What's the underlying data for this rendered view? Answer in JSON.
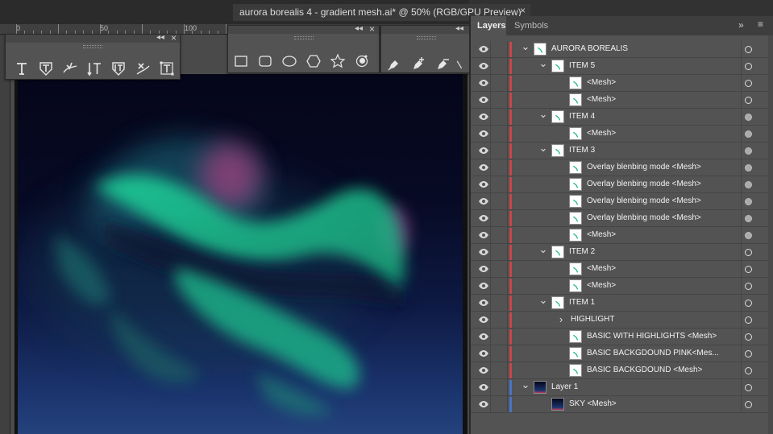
{
  "document": {
    "tab_title": "aurora borealis 4 - gradient mesh.ai* @ 50% (RGB/GPU Preview)",
    "close_glyph": "×"
  },
  "ruler": {
    "labels": [
      "0",
      "50",
      "100"
    ]
  },
  "toolbars": {
    "type_tools": {
      "collapse_glyph": "◂◂",
      "close_glyph": "×",
      "tools": [
        "type-tool-icon",
        "type-on-path-icon",
        "touch-type-icon",
        "vertical-type-icon",
        "area-type-icon",
        "reflect-type-icon",
        "bounding-type-icon"
      ]
    },
    "shape_tools": {
      "collapse_glyph": "◂◂",
      "close_glyph": "×",
      "tools": [
        "rectangle-icon",
        "rounded-rectangle-icon",
        "ellipse-icon",
        "polygon-icon",
        "star-icon",
        "flare-icon"
      ]
    },
    "pen_tools": {
      "collapse_glyph": "◂◂",
      "tools": [
        "pen-icon",
        "add-anchor-icon",
        "delete-anchor-icon",
        "anchor-point-icon"
      ]
    }
  },
  "layers_panel": {
    "tabs": [
      {
        "label": "Layers",
        "active": true
      },
      {
        "label": "Symbols",
        "active": false
      }
    ],
    "collapse_glyph": "»",
    "menu_glyph": "≡",
    "accent_red": "#c8464a",
    "accent_blue": "#4a74c8",
    "rows": [
      {
        "name": "AURORA BOREALIS",
        "depth": 0,
        "expand": "open",
        "color": "red",
        "target_filled": false
      },
      {
        "name": "ITEM 5",
        "depth": 1,
        "expand": "open",
        "color": "red",
        "target_filled": false
      },
      {
        "name": "<Mesh>",
        "depth": 2,
        "expand": "none",
        "color": "red",
        "target_filled": false
      },
      {
        "name": "<Mesh>",
        "depth": 2,
        "expand": "none",
        "color": "red",
        "target_filled": false
      },
      {
        "name": "ITEM 4",
        "depth": 1,
        "expand": "open",
        "color": "red",
        "target_filled": true
      },
      {
        "name": "<Mesh>",
        "depth": 2,
        "expand": "none",
        "color": "red",
        "target_filled": true
      },
      {
        "name": "ITEM 3",
        "depth": 1,
        "expand": "open",
        "color": "red",
        "target_filled": true
      },
      {
        "name": "Overlay blenbing mode <Mesh>",
        "depth": 2,
        "expand": "none",
        "color": "red",
        "target_filled": true
      },
      {
        "name": "Overlay blenbing mode <Mesh>",
        "depth": 2,
        "expand": "none",
        "color": "red",
        "target_filled": true
      },
      {
        "name": "Overlay blenbing mode <Mesh>",
        "depth": 2,
        "expand": "none",
        "color": "red",
        "target_filled": true
      },
      {
        "name": "Overlay blenbing mode <Mesh>",
        "depth": 2,
        "expand": "none",
        "color": "red",
        "target_filled": true
      },
      {
        "name": "<Mesh>",
        "depth": 2,
        "expand": "none",
        "color": "red",
        "target_filled": true
      },
      {
        "name": "ITEM 2",
        "depth": 1,
        "expand": "open",
        "color": "red",
        "target_filled": false
      },
      {
        "name": "<Mesh>",
        "depth": 2,
        "expand": "none",
        "color": "red",
        "target_filled": false
      },
      {
        "name": "<Mesh>",
        "depth": 2,
        "expand": "none",
        "color": "red",
        "target_filled": false
      },
      {
        "name": "ITEM 1",
        "depth": 1,
        "expand": "open",
        "color": "red",
        "target_filled": false
      },
      {
        "name": "HIGHLIGHT",
        "depth": 2,
        "expand": "closed",
        "color": "red",
        "target_filled": false,
        "no_thumb": true
      },
      {
        "name": "BASIC WITH HIGHLIGHTS <Mesh>",
        "depth": 2,
        "expand": "none",
        "color": "red",
        "target_filled": false
      },
      {
        "name": "BASIC BACKGDOUND PINK<Mes...",
        "depth": 2,
        "expand": "none",
        "color": "red",
        "target_filled": false
      },
      {
        "name": "BASIC BACKGDOUND <Mesh>",
        "depth": 2,
        "expand": "none",
        "color": "red",
        "target_filled": false
      },
      {
        "name": "Layer 1",
        "depth": 0,
        "expand": "open",
        "color": "blue",
        "target_filled": false,
        "sky_thumb": true
      },
      {
        "name": "SKY <Mesh>",
        "depth": 1,
        "expand": "none",
        "color": "blue",
        "target_filled": false,
        "sky_thumb": true
      }
    ]
  }
}
